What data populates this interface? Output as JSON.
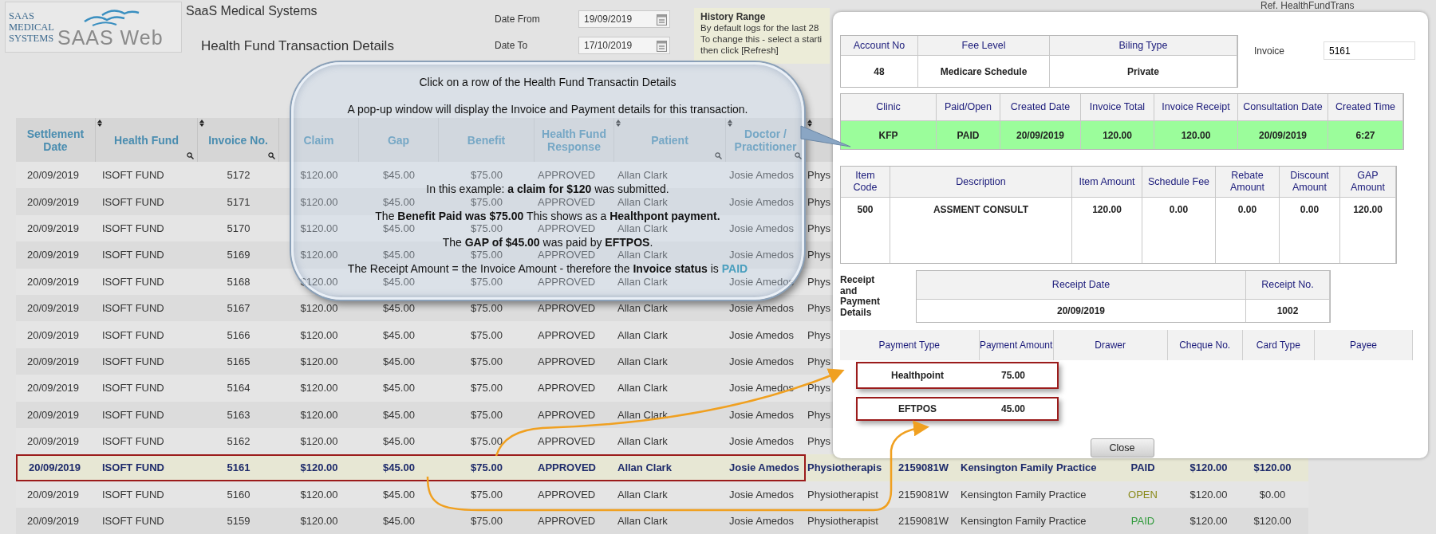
{
  "header": {
    "logo_lines": [
      "SAAS",
      "MEDICAL",
      "SYSTEMS"
    ],
    "logo_wordmark": "SAAS Web",
    "app_title": "SaaS Medical Systems",
    "page_title": "Health Fund Transaction Details",
    "ref": "Ref. HealthFundTrans"
  },
  "date_filters": [
    {
      "label": "Date From",
      "value": "19/09/2019"
    },
    {
      "label": "Date To",
      "value": "17/10/2019"
    }
  ],
  "history_range": {
    "title": "History Range",
    "lines": [
      "By default logs for the last 28",
      "To change this - select a starti",
      "then click [Refresh]"
    ]
  },
  "table": {
    "columns": [
      {
        "label": "Settlement Date",
        "sortable": false,
        "searchable": false
      },
      {
        "label": "Health Fund",
        "sortable": true,
        "searchable": true
      },
      {
        "label": "Invoice No.",
        "sortable": true,
        "searchable": true
      },
      {
        "label": "Claim",
        "sortable": false,
        "searchable": false
      },
      {
        "label": "Gap",
        "sortable": false,
        "searchable": false
      },
      {
        "label": "Benefit",
        "sortable": false,
        "searchable": false
      },
      {
        "label": "Health Fund Response",
        "sortable": false,
        "searchable": false
      },
      {
        "label": "Patient",
        "sortable": true,
        "searchable": true
      },
      {
        "label": "Doctor / Practitioner",
        "sortable": true,
        "searchable": true
      },
      {
        "sortable": true,
        "searchable": false
      }
    ],
    "rows": [
      {
        "selected": false,
        "cells": [
          "20/09/2019",
          "ISOFT FUND",
          "5172",
          "$120.00",
          "$45.00",
          "$75.00",
          "APPROVED",
          "Allan Clark",
          "Josie Amedos",
          "Phys"
        ]
      },
      {
        "selected": false,
        "cells": [
          "20/09/2019",
          "ISOFT FUND",
          "5171",
          "$120.00",
          "$45.00",
          "$75.00",
          "APPROVED",
          "Allan Clark",
          "Josie Amedos",
          "Phys"
        ]
      },
      {
        "selected": false,
        "cells": [
          "20/09/2019",
          "ISOFT FUND",
          "5170",
          "$120.00",
          "$45.00",
          "$75.00",
          "APPROVED",
          "Allan Clark",
          "Josie Amedos",
          "Phys"
        ]
      },
      {
        "selected": false,
        "cells": [
          "20/09/2019",
          "ISOFT FUND",
          "5169",
          "$120.00",
          "$45.00",
          "$75.00",
          "APPROVED",
          "Allan Clark",
          "Josie Amedos",
          "Phys"
        ]
      },
      {
        "selected": false,
        "cells": [
          "20/09/2019",
          "ISOFT FUND",
          "5168",
          "$120.00",
          "$45.00",
          "$75.00",
          "APPROVED",
          "Allan Clark",
          "Josie Amedos",
          "Phys"
        ]
      },
      {
        "selected": false,
        "cells": [
          "20/09/2019",
          "ISOFT FUND",
          "5167",
          "$120.00",
          "$45.00",
          "$75.00",
          "APPROVED",
          "Allan Clark",
          "Josie Amedos",
          "Phys"
        ]
      },
      {
        "selected": false,
        "cells": [
          "20/09/2019",
          "ISOFT FUND",
          "5166",
          "$120.00",
          "$45.00",
          "$75.00",
          "APPROVED",
          "Allan Clark",
          "Josie Amedos",
          "Phys"
        ]
      },
      {
        "selected": false,
        "cells": [
          "20/09/2019",
          "ISOFT FUND",
          "5165",
          "$120.00",
          "$45.00",
          "$75.00",
          "APPROVED",
          "Allan Clark",
          "Josie Amedos",
          "Phys"
        ]
      },
      {
        "selected": false,
        "cells": [
          "20/09/2019",
          "ISOFT FUND",
          "5164",
          "$120.00",
          "$45.00",
          "$75.00",
          "APPROVED",
          "Allan Clark",
          "Josie Amedos",
          "Phys"
        ]
      },
      {
        "selected": false,
        "cells": [
          "20/09/2019",
          "ISOFT FUND",
          "5163",
          "$120.00",
          "$45.00",
          "$75.00",
          "APPROVED",
          "Allan Clark",
          "Josie Amedos",
          "Phys"
        ]
      },
      {
        "selected": false,
        "cells": [
          "20/09/2019",
          "ISOFT FUND",
          "5162",
          "$120.00",
          "$45.00",
          "$75.00",
          "APPROVED",
          "Allan Clark",
          "Josie Amedos",
          "Phys"
        ]
      },
      {
        "selected": true,
        "cells": [
          "20/09/2019",
          "ISOFT FUND",
          "5161",
          "$120.00",
          "$45.00",
          "$75.00",
          "APPROVED",
          "Allan Clark",
          "Josie Amedos",
          "Physiotherapis",
          "2159081W",
          "Kensington Family Practice",
          "PAID",
          "$120.00",
          "$120.00"
        ]
      },
      {
        "selected": false,
        "color": "#8a8a1a",
        "cells": [
          "20/09/2019",
          "ISOFT FUND",
          "5160",
          "$120.00",
          "$45.00",
          "$75.00",
          "APPROVED",
          "Allan Clark",
          "Josie Amedos",
          "Physiotherapist",
          "2159081W",
          "Kensington Family Practice",
          "OPEN",
          "$120.00",
          "$0.00"
        ]
      },
      {
        "selected": false,
        "color": "#2e9a3a",
        "cells": [
          "20/09/2019",
          "ISOFT FUND",
          "5159",
          "$120.00",
          "$45.00",
          "$75.00",
          "APPROVED",
          "Allan Clark",
          "Josie Amedos",
          "Physiotherapist",
          "2159081W",
          "Kensington Family Practice",
          "PAID",
          "$120.00",
          "$120.00"
        ]
      }
    ]
  },
  "callout": {
    "paragraphs": [
      {
        "text": "Click on a row of the Health Fund Transactin Details"
      },
      {
        "text": "A pop-up window will display the Invoice and Payment details for this transaction."
      },
      {
        "text": "In this example: **a claim for $120** was submitted."
      },
      {
        "text": "The **Benefit Paid was $75.00** This shows as a **Healthpont payment.**"
      },
      {
        "text": "The **GAP of $45.00** was paid by **EFTPOS**."
      },
      {
        "text": "The Receipt Amount = the Invoice Amount - therefore the **Invoice status** is",
        "status": "PAID"
      }
    ]
  },
  "popup": {
    "account_table": {
      "columns": [
        "Account No",
        "Fee Level",
        "Biling Type"
      ],
      "values": [
        "48",
        "Medicare Schedule",
        "Private"
      ]
    },
    "invoice": {
      "label": "Invoice",
      "value": "5161"
    },
    "invoice_table": {
      "columns": [
        "Clinic",
        "Paid/Open",
        "Created Date",
        "Invoice Total",
        "Invoice Receipt",
        "Consultation Date",
        "Created Time"
      ],
      "highlighted": true,
      "values": [
        "KFP",
        "PAID",
        "20/09/2019",
        "120.00",
        "120.00",
        "20/09/2019",
        "6:27"
      ]
    },
    "items_table": {
      "columns": [
        "Item Code",
        "Description",
        "Item Amount",
        "Schedule Fee",
        "Rebate Amount",
        "Discount Amount",
        "GAP Amount"
      ],
      "rows": [
        [
          "500",
          "ASSMENT CONSULT",
          "120.00",
          "0.00",
          "0.00",
          "0.00",
          "120.00"
        ]
      ]
    },
    "receipt_label": "Receipt and Payment Details",
    "receipt_table": {
      "columns": [
        "Receipt Date",
        "Receipt No."
      ],
      "values": [
        "20/09/2019",
        "1002"
      ]
    },
    "payments_table": {
      "columns": [
        "Payment Type",
        "Payment Amount",
        "Drawer",
        "Cheque No.",
        "Card Type",
        "Payee"
      ],
      "rows": [
        {
          "highlighted": true,
          "cells": [
            "Healthpoint",
            "75.00"
          ]
        },
        {
          "highlighted": true,
          "cells": [
            "EFTPOS",
            "45.00"
          ]
        }
      ]
    },
    "close_button": "Close"
  }
}
